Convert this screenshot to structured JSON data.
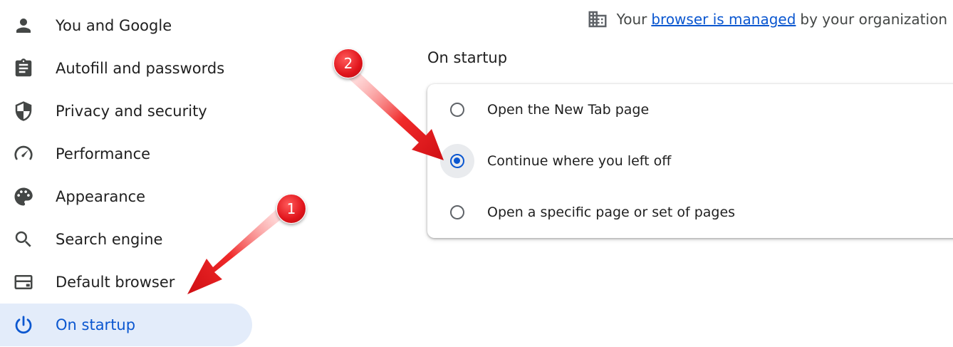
{
  "sidebar": {
    "items": [
      {
        "label": "You and Google",
        "icon": "person-icon"
      },
      {
        "label": "Autofill and passwords",
        "icon": "clipboard-icon"
      },
      {
        "label": "Privacy and security",
        "icon": "shield-icon"
      },
      {
        "label": "Performance",
        "icon": "speedometer-icon"
      },
      {
        "label": "Appearance",
        "icon": "palette-icon"
      },
      {
        "label": "Search engine",
        "icon": "search-icon"
      },
      {
        "label": "Default browser",
        "icon": "browser-window-icon"
      },
      {
        "label": "On startup",
        "icon": "power-icon",
        "active": true
      }
    ]
  },
  "managed": {
    "prefix": "Your",
    "link": "browser is managed",
    "suffix": "by your organization",
    "icon": "building-icon"
  },
  "section": {
    "title": "On startup",
    "options": [
      {
        "label": "Open the New Tab page",
        "selected": false
      },
      {
        "label": "Continue where you left off",
        "selected": true
      },
      {
        "label": "Open a specific page or set of pages",
        "selected": false
      }
    ]
  },
  "annotations": {
    "badges": [
      "1",
      "2"
    ],
    "color": "#e0141b"
  },
  "colors": {
    "accent": "#0b57d0",
    "active_bg": "#e3ecfa",
    "icon_gray": "#444746"
  }
}
